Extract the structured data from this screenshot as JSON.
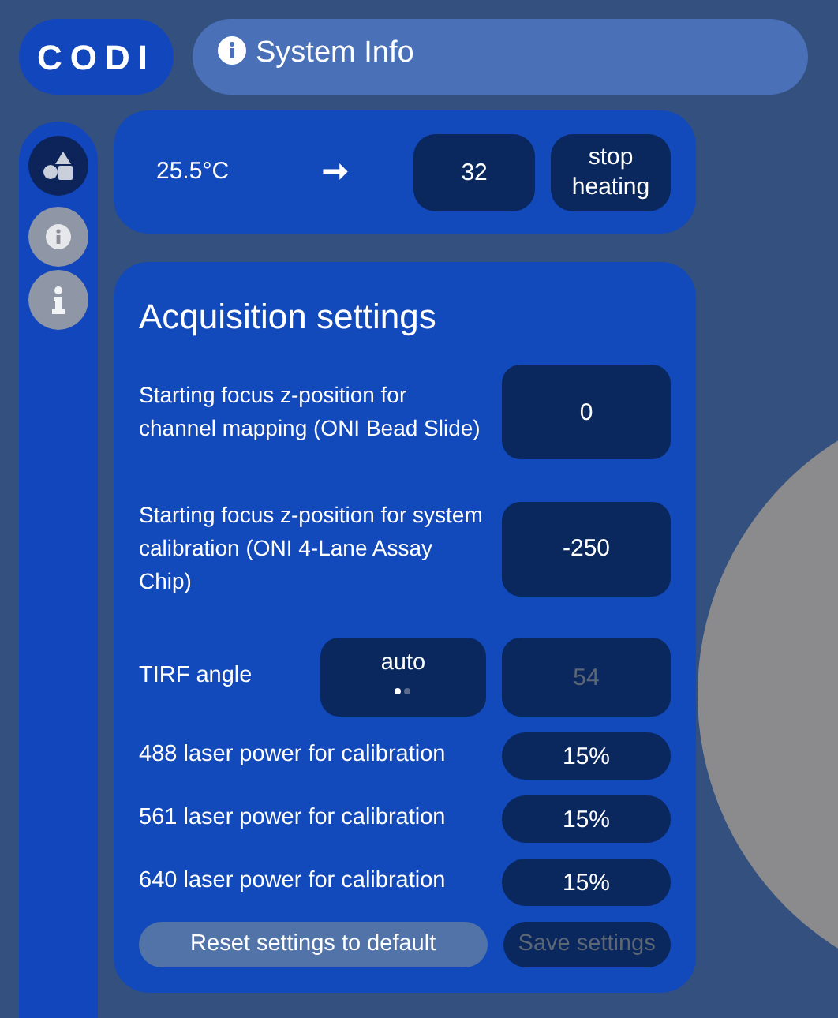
{
  "logo": "CODI",
  "header": {
    "title": "System Info"
  },
  "sidebar": {
    "items": [
      {
        "kind": "shapes",
        "selected": true
      },
      {
        "kind": "info-circle",
        "selected": false
      },
      {
        "kind": "info",
        "selected": false
      }
    ]
  },
  "temperature": {
    "current": "25.5°C",
    "arrow": "➞",
    "target": "32",
    "button": "stop heating"
  },
  "acquisition": {
    "title": "Acquisition settings",
    "fields": [
      {
        "kind": "tall",
        "label": "Starting focus z-position for channel mapping (ONI Bead Slide)",
        "value": "0"
      },
      {
        "kind": "tall",
        "label": "Starting focus z-position for system calibration (ONI 4-Lane Assay Chip)",
        "value": "-250"
      },
      {
        "kind": "toggle",
        "label": "TIRF angle",
        "mode": "auto",
        "pages": [
          {
            "selected": true
          },
          {
            "selected": false
          }
        ],
        "value": "54",
        "disabled": true
      },
      {
        "kind": "short",
        "label": "488 laser power for calibration",
        "value": "15%"
      },
      {
        "kind": "short",
        "label": "561 laser power for calibration",
        "value": "15%"
      },
      {
        "kind": "short",
        "label": "640 laser power for calibration",
        "value": "15%"
      }
    ],
    "reset_button": {
      "label": "Reset settings to default",
      "disabled": false
    },
    "save_button": {
      "label": "Save settings",
      "disabled": true
    }
  }
}
